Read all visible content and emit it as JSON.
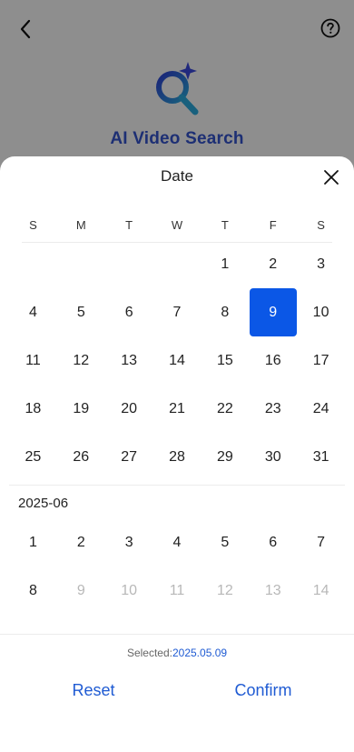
{
  "app": {
    "title": "AI Video Search"
  },
  "sheet": {
    "title": "Date"
  },
  "weekdays": [
    "S",
    "M",
    "T",
    "W",
    "T",
    "F",
    "S"
  ],
  "month1": {
    "rows": [
      [
        "",
        "",
        "",
        "",
        "1",
        "2",
        "3"
      ],
      [
        "4",
        "5",
        "6",
        "7",
        "8",
        "9",
        "10"
      ],
      [
        "11",
        "12",
        "13",
        "14",
        "15",
        "16",
        "17"
      ],
      [
        "18",
        "19",
        "20",
        "21",
        "22",
        "23",
        "24"
      ],
      [
        "25",
        "26",
        "27",
        "28",
        "29",
        "30",
        "31"
      ]
    ],
    "selected_day": "9"
  },
  "month2": {
    "label": "2025-06",
    "rows": [
      [
        "1",
        "2",
        "3",
        "4",
        "5",
        "6",
        "7"
      ],
      [
        "8",
        "9",
        "10",
        "11",
        "12",
        "13",
        "14"
      ]
    ],
    "enabled_through": "8"
  },
  "footer": {
    "selected_prefix": "Selected:",
    "selected_value": "2025.05.09",
    "reset_label": "Reset",
    "confirm_label": "Confirm"
  },
  "colors": {
    "accent": "#0b57e6",
    "link": "#1f5bd3",
    "muted": "#b8b8b8"
  },
  "icons": {
    "back": "chevron-left-icon",
    "help": "question-circle-icon",
    "close": "close-icon",
    "logo": "search-sparkle-icon"
  }
}
